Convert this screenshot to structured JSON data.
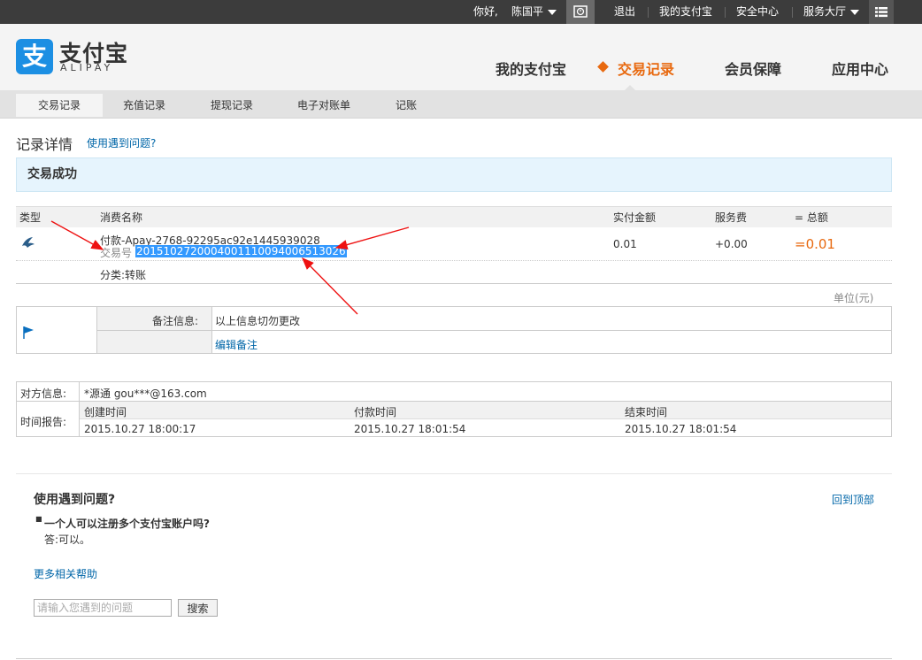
{
  "topbar": {
    "greeting": "你好,",
    "user": "陈国平",
    "logout": "退出",
    "my_alipay": "我的支付宝",
    "security": "安全中心",
    "service": "服务大厅"
  },
  "logo": {
    "glyph": "支",
    "cn": "支付宝",
    "en": "ALIPAY",
    "color": "#1c8fe3"
  },
  "main_nav": [
    "我的支付宝",
    "交易记录",
    "会员保障",
    "应用中心"
  ],
  "sub_nav": [
    "交易记录",
    "充值记录",
    "提现记录",
    "电子对账单",
    "记账"
  ],
  "page": {
    "title": "记录详情",
    "help_link": "使用遇到问题?",
    "status": "交易成功"
  },
  "table": {
    "headers": [
      "类型",
      "消费名称",
      "实付金额",
      "服务费",
      "= 总额"
    ],
    "name": "付款-Apay-2768-92295ac92e1445939028",
    "trade_no_label": "交易号",
    "trade_no": "2015102720004001110094006513026",
    "amount": "0.01",
    "fee": "+0.00",
    "total": "=0.01",
    "category": "分类:转账",
    "unit": "单位(元)"
  },
  "remark": {
    "label": "备注信息:",
    "value": "以上信息切勿更改",
    "edit": "编辑备注"
  },
  "party": {
    "label": "对方信息:",
    "value": "*源通  gou***@163.com",
    "time_label": "时间报告:",
    "times": [
      {
        "label": "创建时间",
        "value": "2015.10.27 18:00:17"
      },
      {
        "label": "付款时间",
        "value": "2015.10.27 18:01:54"
      },
      {
        "label": "结束时间",
        "value": "2015.10.27 18:01:54"
      }
    ]
  },
  "help": {
    "title": "使用遇到问题?",
    "back_top": "回到顶部",
    "question": "一个人可以注册多个支付宝账户吗?",
    "answer": "答:可以。",
    "more": "更多相关帮助",
    "search_placeholder": "请输入您遇到的问题",
    "search_button": "搜索"
  },
  "colors": {
    "accent": "#e8690f",
    "link": "#0066a8",
    "highlight": "#3399ff",
    "annotation": "#ee1111"
  }
}
